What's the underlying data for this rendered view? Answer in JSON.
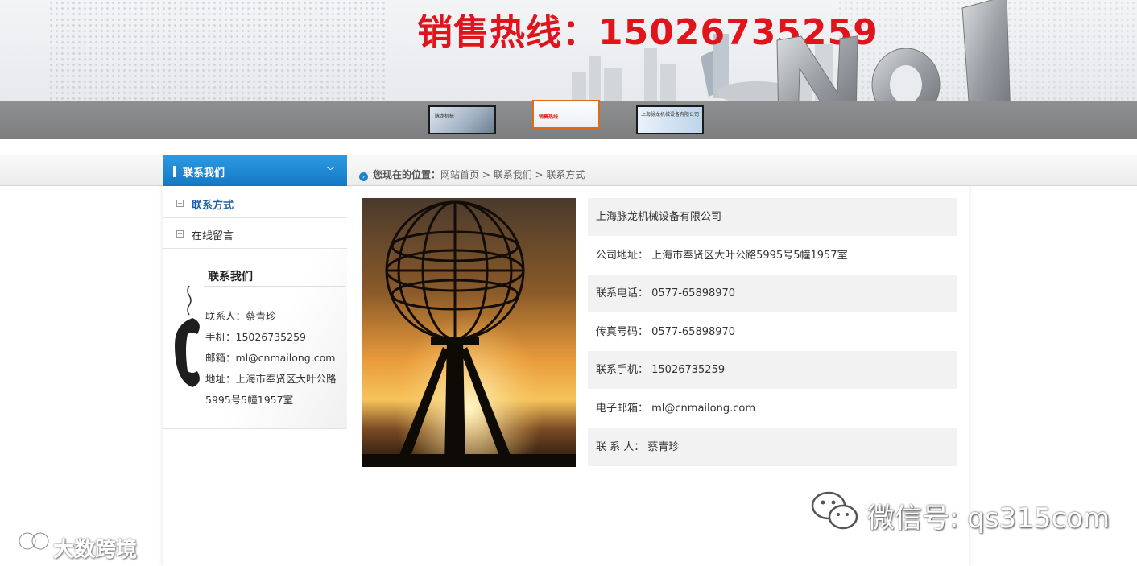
{
  "banner": {
    "slogan": "销售热线：15026735259",
    "thumbnails": [
      {
        "id": "slide-1",
        "text": "脉龙机械"
      },
      {
        "id": "slide-2",
        "text": "销售热线"
      },
      {
        "id": "slide-3",
        "text": "上海脉龙机械设备有限公司"
      }
    ]
  },
  "sidebar": {
    "header": "联系我们",
    "items": [
      {
        "label": "联系方式",
        "active": true
      },
      {
        "label": "在线留言",
        "active": false
      }
    ],
    "contact": {
      "title": "联系我们",
      "person": "联系人：蔡青珍",
      "mobile": "手机：15026735259",
      "email": "邮箱：ml@cnmailong.com",
      "address_1": "地址：上海市奉贤区大叶公路",
      "address_2": "5995号5幢1957室"
    }
  },
  "breadcrumb": {
    "label": "您现在的位置：",
    "home": "网站首页",
    "sep1": " > ",
    "section": "联系我们",
    "sep2": " > ",
    "current": "联系方式"
  },
  "info": {
    "company": "上海脉龙机械设备有限公司",
    "address": "公司地址：  上海市奉贤区大叶公路5995号5幢1957室",
    "phone": "联系电话： 0577-65898970",
    "fax": "传真号码：  0577-65898970",
    "mobile": "联系手机： 15026735259",
    "email": "电子邮箱：  ml@cnmailong.com",
    "contact": "联  系  人：   蔡青珍"
  },
  "watermarks": {
    "wechat": "微信号: qs315com",
    "brand": "大数跨境"
  },
  "colors": {
    "slogan_red": "#e0141c",
    "sidebar_blue": "#1578c4",
    "active_link": "#1a62a8"
  }
}
